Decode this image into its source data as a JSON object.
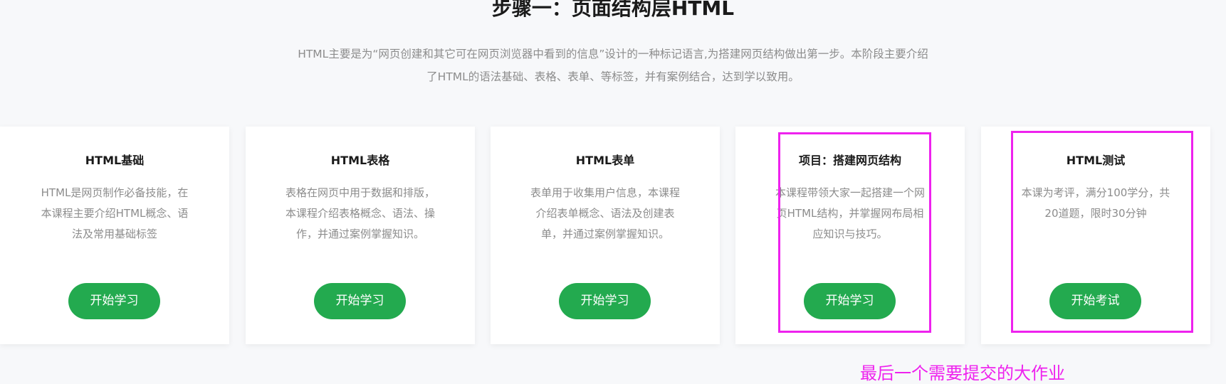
{
  "header": {
    "title": "步骤一：页面结构层HTML",
    "description_line1": "HTML主要是为“网页创建和其它可在网页浏览器中看到的信息”设计的一种标记语言,为搭建网页结构做出第一步。本阶段主要介绍",
    "description_line2": "了HTML的语法基础、表格、表单、等标签，并有案例结合，达到学以致用。"
  },
  "cards": [
    {
      "title": "HTML基础",
      "desc_lines": [
        "HTML是网页制作必备技能，在",
        "本课程主要介绍HTML概念、语",
        "法及常用基础标签"
      ],
      "button": "开始学习"
    },
    {
      "title": "HTML表格",
      "desc_lines": [
        "表格在网页中用于数据和排版，",
        "本课程介绍表格概念、语法、操",
        "作，并通过案例掌握知识。"
      ],
      "button": "开始学习"
    },
    {
      "title": "HTML表单",
      "desc_lines": [
        "表单用于收集用户信息，本课程",
        "介绍表单概念、语法及创建表",
        "单，并通过案例掌握知识。"
      ],
      "button": "开始学习"
    },
    {
      "title": "项目：搭建网页结构",
      "desc_lines": [
        "本课程带领大家一起搭建一个网",
        "页HTML结构，并掌握网布局相",
        "应知识与技巧。"
      ],
      "button": "开始学习"
    },
    {
      "title": "HTML测试",
      "desc_lines": [
        "本课为考评，满分100学分，共",
        "20道题，限时30分钟"
      ],
      "button": "开始考试"
    }
  ],
  "annotation": {
    "text": "最后一个需要提交的大作业",
    "color": "#ee22ee"
  },
  "colors": {
    "background": "#f7f8fa",
    "button": "#23aa4f",
    "muted_text": "#8c8c8c"
  }
}
